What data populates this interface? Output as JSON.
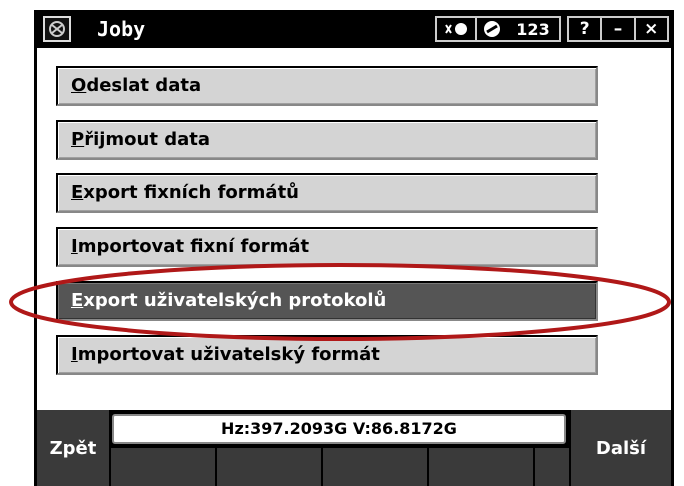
{
  "window": {
    "title": "Joby",
    "indicator_label": "123",
    "help_label": "?",
    "minimize_label": "–",
    "close_label": "×"
  },
  "menu": {
    "items": [
      {
        "accel": "O",
        "rest": "deslat data"
      },
      {
        "accel": "P",
        "rest": "řijmout data"
      },
      {
        "accel": "E",
        "rest": "xport fixních formátů"
      },
      {
        "accel": "I",
        "rest": "mportovat fixní formát"
      },
      {
        "accel": "E",
        "rest": "xport uživatelských protokolů",
        "selected": true
      },
      {
        "accel": "I",
        "rest": "mportovat uživatelský formát"
      }
    ]
  },
  "status": {
    "readout": "Hz:397.2093G  V:86.8172G"
  },
  "softkeys": {
    "back_label": "Zpět",
    "next_label": "Další"
  },
  "colors": {
    "selected_bg": "#555555",
    "button_bg": "#d4d4d4",
    "annotation": "#b01818"
  }
}
